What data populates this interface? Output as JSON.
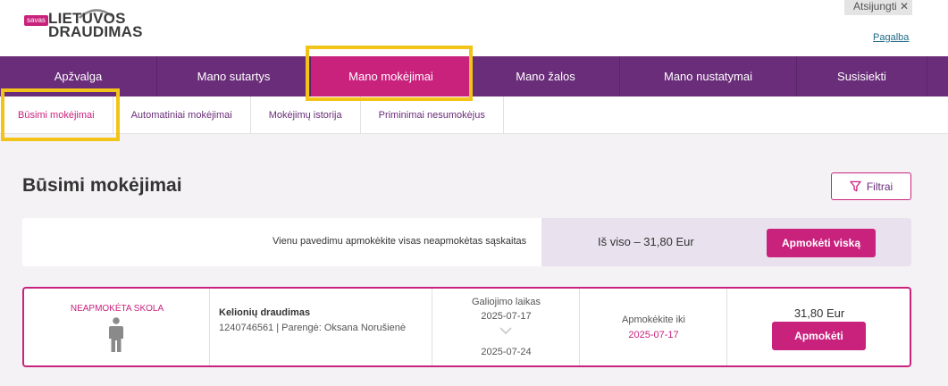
{
  "header": {
    "logo_badge": "savas",
    "logo_line1": "LIETUVOS",
    "logo_line2": "DRAUDIMAS",
    "logout_label": "Atsijungti",
    "help_label": "Pagalba"
  },
  "nav": {
    "items": [
      {
        "label": "Apžvalga"
      },
      {
        "label": "Mano sutartys"
      },
      {
        "label": "Mano mokėjimai",
        "active": true
      },
      {
        "label": "Mano žalos"
      },
      {
        "label": "Mano nustatymai"
      },
      {
        "label": "Susisiekti"
      },
      {
        "label": ""
      }
    ]
  },
  "subnav": {
    "items": [
      {
        "label": "Būsimi mokėjimai",
        "active": true
      },
      {
        "label": "Automatiniai mokėjimai"
      },
      {
        "label": "Mokėjimų istorija"
      },
      {
        "label": "Priminimai nesumokėjus"
      }
    ]
  },
  "page": {
    "title": "Būsimi mokėjimai",
    "filter_label": "Filtrai"
  },
  "payall": {
    "text": "Vienu pavedimu apmokėkite visas neapmokėtas sąskaitas",
    "total_text": "Iš viso – 31,80 Eur",
    "button_label": "Apmokėti viską"
  },
  "debt": {
    "status": "NEAPMOKĖTA SKOLA",
    "product": "Kelionių draudimas",
    "policy": "1240746561 | Parengė: Oksana Norušienė",
    "validity_label": "Galiojimo laikas",
    "date_from": "2025-07-17",
    "date_to": "2025-07-24",
    "pay_by_label": "Apmokėkite iki",
    "pay_by_date": "2025-07-17",
    "amount": "31,80 Eur",
    "pay_label": "Apmokėti"
  },
  "colors": {
    "brand_purple": "#6a2d7a",
    "brand_magenta": "#c9227d",
    "highlight": "#f2c318"
  }
}
